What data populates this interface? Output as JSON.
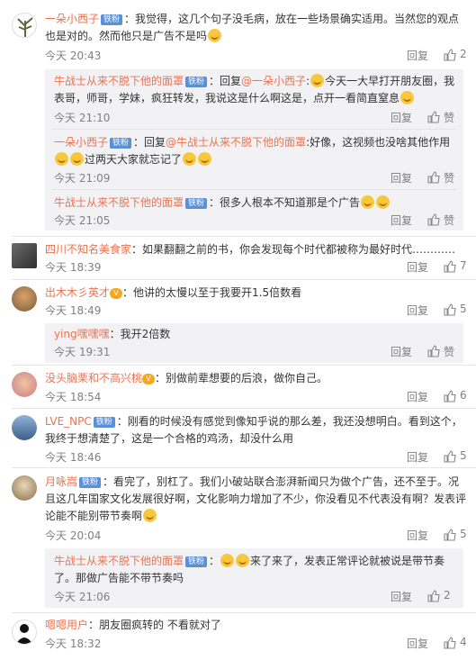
{
  "labels": {
    "reply": "回复",
    "like": "赞"
  },
  "comments": [
    {
      "user": "一朵小西子",
      "badge": "铁粉",
      "text1": "：我觉得，这几个句子没毛病，放在一些场景确实适用。当然您的观点",
      "text2": "也是对的。然而他只是广告不是吗",
      "time": "今天 20:43",
      "likes": "2",
      "replies": [
        {
          "user": "牛战士从来不脱下他的面罩",
          "badge": "铁粉",
          "text1": "：回复",
          "mention": "@一朵小西子",
          "text1b": ":",
          "text1c": "今天一大早打开朋友圈，我",
          "text2": "表哥，师哥，学妹，疯狂转发，我说这是什么啊这是，点开一看简直窒息",
          "time": "今天 21:10",
          "likes": "赞"
        },
        {
          "user": "一朵小西子",
          "badge": "铁粉",
          "text1": "：回复",
          "mention": "@牛战士从来不脱下他的面罩",
          "text1b": ":好像，这视频也没啥其他作用",
          "text2": "过两天大家就忘记了",
          "time": "今天 21:09",
          "likes": "赞"
        },
        {
          "user": "牛战士从来不脱下他的面罩",
          "badge": "铁粉",
          "text1": "：很多人根本不知道那是个广告",
          "time": "今天 21:05",
          "likes": "赞"
        }
      ]
    },
    {
      "user": "四川不知名美食家",
      "text1": "：如果翻翻之前的书，你会发现每个时代都被称为最好时代…………",
      "time": "今天 18:39",
      "likes": "7"
    },
    {
      "user": "出木木彡英才",
      "text1": "：他讲的太慢以至于我要开1.5倍数看",
      "time": "今天 18:49",
      "likes": "5",
      "replies": [
        {
          "user": "ying嘿嘿嘿",
          "text1": "：我开2倍数",
          "time": "今天 19:31",
          "likes": "赞"
        }
      ]
    },
    {
      "user": "没头脑栗和不高兴桃",
      "text1": "：别做前辈想要的后浪，做你自己。",
      "time": "今天 18:54",
      "likes": "6"
    },
    {
      "user": "LVE_NPC",
      "badge": "铁粉",
      "text1": "：刚看的时候没有感觉到像知乎说的那么差，我还没想明白。看到这个，",
      "text2": "我终于想清楚了，这是一个合格的鸡汤，却没什么用",
      "time": "今天 18:46",
      "likes": "5"
    },
    {
      "user": "月咏嵩",
      "badge": "铁粉",
      "text1": "：看完了，别杠了。我们小破站联合澎湃新闻只为做个广告，还不至于。况",
      "text2": "且这几年国家文化发展很好啊，文化影响力增加了不少，你没看见不代表没有啊？发表评",
      "text3": "论能不能别带节奏啊",
      "time": "今天 20:04",
      "likes": "5",
      "replies": [
        {
          "user": "牛战士从来不脱下他的面罩",
          "badge": "铁粉",
          "text1": "：",
          "text1c": "来了来了，发表正常评论就被说是带节奏",
          "text2": "了。那做广告能不带节奏吗",
          "time": "今天 21:06",
          "likes": "2"
        }
      ]
    },
    {
      "user": "嗯嗯用户",
      "text1": "：朋友圈疯转的 不看就对了",
      "time": "今天 18:32",
      "likes": "4"
    }
  ]
}
